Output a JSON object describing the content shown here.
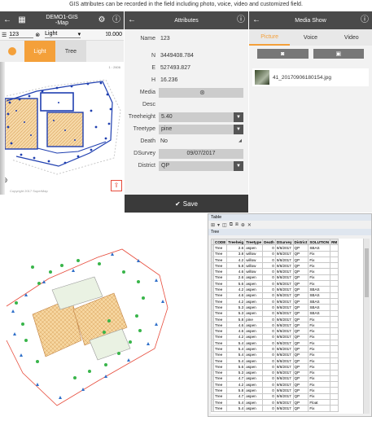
{
  "caption": "GIS attributes can be recorded in the field including photo, voice, video and customized field.",
  "map_screen": {
    "title_line1": "DEMO1-GIS",
    "title_line2": "-Map",
    "search_value": "123",
    "layer_select": "Light",
    "scale_value": "0.000",
    "tabs": [
      "Light",
      "Tree"
    ],
    "scale_label": "1 : 2606",
    "copyright": "Copyright 2017 SuperMap",
    "icons": [
      "back-arrow-icon",
      "map-icon",
      "gear-icon",
      "help-icon",
      "list-icon",
      "clear-icon",
      "chevron-down-icon",
      "ruler-icon",
      "compass-icon",
      "locate-icon",
      "export-icon"
    ]
  },
  "attributes_screen": {
    "title": "Attributes",
    "fields": [
      {
        "label": "Name",
        "value": "123"
      },
      {
        "label": "N",
        "value": "3449408.784"
      },
      {
        "label": "E",
        "value": "527493.827"
      },
      {
        "label": "H",
        "value": "16.236"
      }
    ],
    "media_label": "Media",
    "desc_label": "Desc",
    "treeheight_label": "Treeheight",
    "treeheight_value": "5.40",
    "treetype_label": "Treetype",
    "treetype_value": "pine",
    "death_label": "Death",
    "death_value": "No",
    "dsurvey_label": "DSurvey",
    "dsurvey_value": "09/07/2017",
    "district_label": "District",
    "district_value": "QP",
    "save_label": "Save"
  },
  "media_screen": {
    "title": "Media Show",
    "tabs": [
      "Picture",
      "Voice",
      "Video"
    ],
    "active_tab": "Picture",
    "file_name": "41_20170906180154.jpg"
  },
  "table_window": {
    "title": "Table",
    "layer_name": "Tree",
    "columns": [
      "CODE",
      "Treeheig",
      "Treetype",
      "Death",
      "DSurvey",
      "District",
      "SOLUTION",
      "RM"
    ],
    "rows": [
      [
        "Tree",
        "2.6",
        "aspen",
        "0",
        "9/6/2017",
        "QP",
        "SBAS",
        ""
      ],
      [
        "Tree",
        "3.8",
        "willow",
        "0",
        "9/6/2017",
        "QP",
        "Fix",
        ""
      ],
      [
        "Tree",
        "4.2",
        "willow",
        "0",
        "9/6/2017",
        "QP",
        "Fix",
        ""
      ],
      [
        "Tree",
        "5.8",
        "willow",
        "0",
        "9/6/2017",
        "QP",
        "Fix",
        ""
      ],
      [
        "Tree",
        "4.6",
        "willow",
        "0",
        "9/6/2017",
        "QP",
        "Fix",
        ""
      ],
      [
        "Tree",
        "2.6",
        "aspen",
        "0",
        "9/6/2017",
        "QP",
        "Fix",
        ""
      ],
      [
        "Tree",
        "5.6",
        "aspen",
        "0",
        "9/6/2017",
        "QP",
        "Fix",
        ""
      ],
      [
        "Tree",
        "4.2",
        "aspen",
        "0",
        "9/6/2017",
        "QP",
        "SBAS",
        ""
      ],
      [
        "Tree",
        "4.6",
        "aspen",
        "0",
        "9/6/2017",
        "QP",
        "SBAS",
        ""
      ],
      [
        "Tree",
        "4.2",
        "aspen",
        "0",
        "9/6/2017",
        "QP",
        "SBAS",
        ""
      ],
      [
        "Tree",
        "5.3",
        "aspen",
        "0",
        "9/6/2017",
        "QP",
        "SBAS",
        ""
      ],
      [
        "Tree",
        "5.3",
        "aspen",
        "0",
        "9/6/2017",
        "QP",
        "SBAS",
        ""
      ],
      [
        "Tree",
        "5.8",
        "pine",
        "0",
        "9/6/2017",
        "QP",
        "Fix",
        ""
      ],
      [
        "Tree",
        "4.6",
        "aspen",
        "0",
        "9/6/2017",
        "QP",
        "Fix",
        ""
      ],
      [
        "Tree",
        "4.6",
        "aspen",
        "0",
        "9/6/2017",
        "QP",
        "Fix",
        ""
      ],
      [
        "Tree",
        "4.2",
        "aspen",
        "0",
        "9/6/2017",
        "QP",
        "Fix",
        ""
      ],
      [
        "Tree",
        "5.4",
        "aspen",
        "0",
        "9/6/2017",
        "QP",
        "Fix",
        ""
      ],
      [
        "Tree",
        "5.4",
        "aspen",
        "0",
        "9/6/2017",
        "QP",
        "Fix",
        ""
      ],
      [
        "Tree",
        "5.4",
        "aspen",
        "0",
        "9/6/2017",
        "QP",
        "Fix",
        ""
      ],
      [
        "Tree",
        "5.4",
        "aspen",
        "0",
        "9/6/2017",
        "QP",
        "Fix",
        ""
      ],
      [
        "Tree",
        "5.6",
        "aspen",
        "0",
        "9/6/2017",
        "QP",
        "Fix",
        ""
      ],
      [
        "Tree",
        "5.3",
        "aspen",
        "0",
        "9/6/2017",
        "QP",
        "Fix",
        ""
      ],
      [
        "Tree",
        "4.7",
        "aspen",
        "0",
        "9/6/2017",
        "QP",
        "Fix",
        ""
      ],
      [
        "Tree",
        "4.2",
        "aspen",
        "0",
        "9/6/2017",
        "QP",
        "Fix",
        ""
      ],
      [
        "Tree",
        "5.8",
        "aspen",
        "0",
        "9/6/2017",
        "QP",
        "Fix",
        ""
      ],
      [
        "Tree",
        "4.7",
        "aspen",
        "0",
        "9/6/2017",
        "QP",
        "Fix",
        ""
      ],
      [
        "Tree",
        "5.4",
        "aspen",
        "0",
        "9/6/2017",
        "QP",
        "Float",
        ""
      ],
      [
        "Tree",
        "5.4",
        "aspen",
        "0",
        "9/6/2017",
        "QP",
        "Fix",
        ""
      ]
    ]
  },
  "colors": {
    "accent": "#f4a03a",
    "appbar": "#4a4a4a",
    "parcel": "#f3cf95",
    "polygon": "#1f3fb0",
    "tree": "#39b54a",
    "light": "#1f3fb0",
    "boundary": "#e74c3c"
  }
}
